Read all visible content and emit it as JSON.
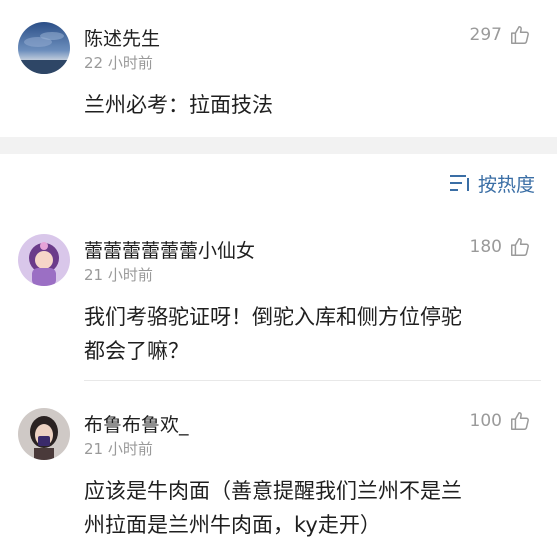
{
  "post": {
    "author": "陈述先生",
    "time": "22 小时前",
    "likes": "297",
    "content": "兰州必考：拉面技法"
  },
  "sort": {
    "label": "按热度"
  },
  "comments": [
    {
      "author": "蕾蕾蕾蕾蕾蕾小仙女",
      "time": "21 小时前",
      "likes": "180",
      "text_lines": [
        "我们考骆驼证呀！倒驼入库和侧方位停驼",
        "都会了嘛？"
      ]
    },
    {
      "author": "布鲁布鲁欢_",
      "time": "21 小时前",
      "likes": "100",
      "text_lines": [
        "应该是牛肉面（善意提醒我们兰州不是兰",
        "州拉面是兰州牛肉面，ky走开）"
      ]
    }
  ],
  "icons": {
    "like": "thumbs-up-icon",
    "sort": "sort-lines-icon"
  },
  "colors": {
    "link": "#3a6ea5",
    "muted": "#9a9a9a",
    "band": "#f2f2f2"
  }
}
